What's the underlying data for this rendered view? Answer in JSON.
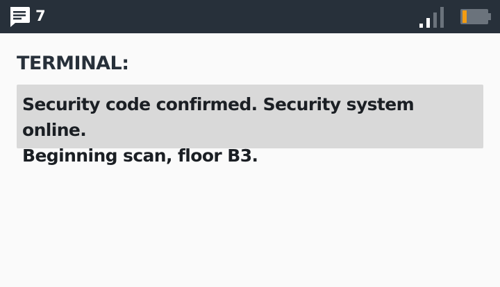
{
  "status_bar": {
    "notification_icon": "chat-message-icon",
    "notification_count": "7",
    "signal_icon": "signal-strength-icon",
    "signal_bars_active": 2,
    "signal_bars_total": 4,
    "battery_icon": "battery-low-icon",
    "battery_level": 0.15,
    "battery_color": "#f39c12",
    "background_color": "#27303a"
  },
  "terminal": {
    "label": "TERMINAL:",
    "message": "Security code confirmed. Security system online.\nBeginning scan, floor B3."
  }
}
